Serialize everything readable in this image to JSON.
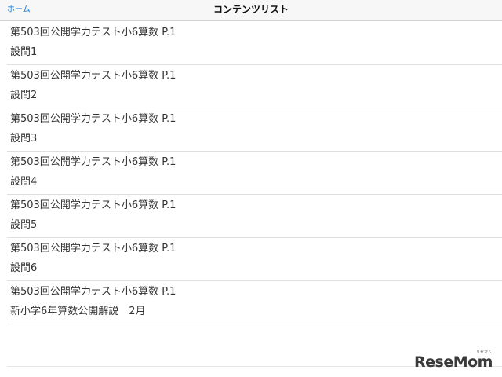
{
  "navbar": {
    "back_label": "ホーム",
    "title": "コンテンツリスト"
  },
  "list": {
    "items": [
      {
        "title": "第503回公開学力テスト小6算数 P.1",
        "subtitle": "設問1"
      },
      {
        "title": "第503回公開学力テスト小6算数 P.1",
        "subtitle": "設問2"
      },
      {
        "title": "第503回公開学力テスト小6算数 P.1",
        "subtitle": "設問3"
      },
      {
        "title": "第503回公開学力テスト小6算数 P.1",
        "subtitle": "設問4"
      },
      {
        "title": "第503回公開学力テスト小6算数 P.1",
        "subtitle": "設問5"
      },
      {
        "title": "第503回公開学力テスト小6算数 P.1",
        "subtitle": "設問6"
      },
      {
        "title": "第503回公開学力テスト小6算数 P.1",
        "subtitle": "新小学6年算数公開解説　2月"
      }
    ]
  },
  "watermark": {
    "text": "ReseMom",
    "small": "リセマム"
  },
  "colors": {
    "accent": "#1a7ad6",
    "navbar_bg": "#f7f7f7",
    "text": "#333333",
    "separator": "#dedede"
  }
}
